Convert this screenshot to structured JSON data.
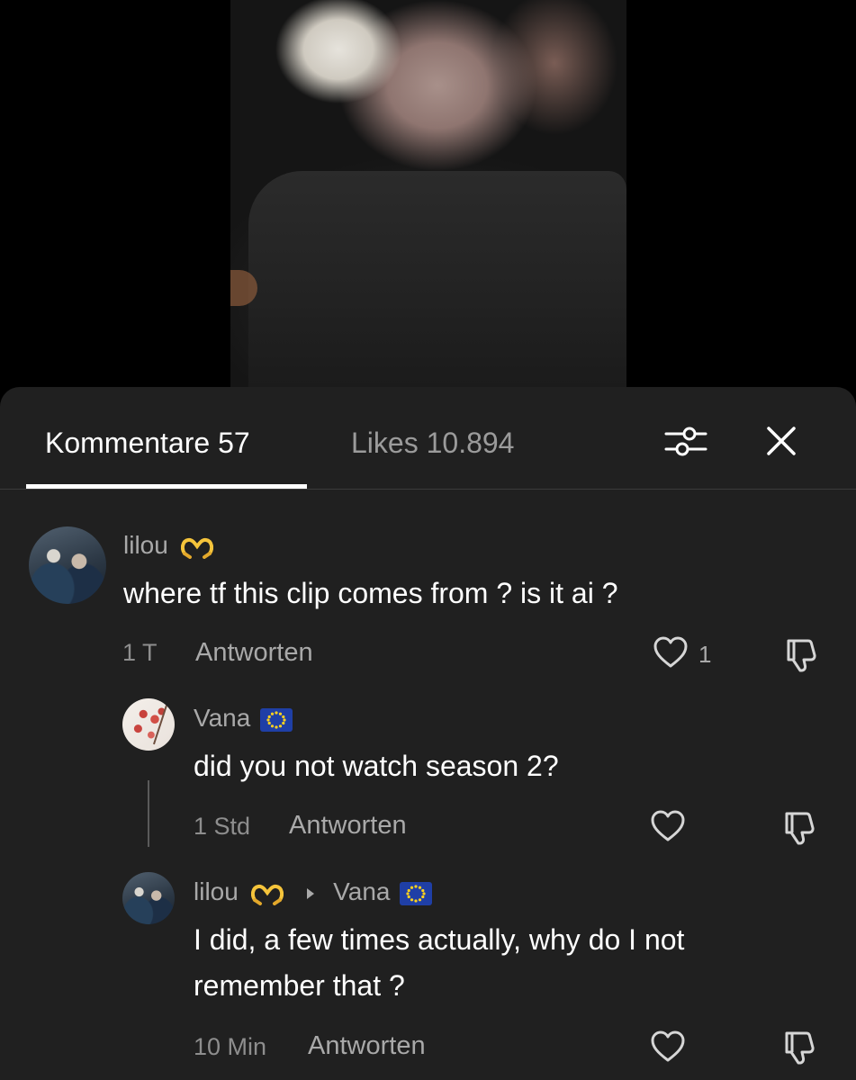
{
  "tabs": {
    "comments_label": "Kommentare 57",
    "likes_label": "Likes 10.894"
  },
  "icons": {
    "filter": "filter-sliders-icon",
    "close": "close-icon",
    "like": "heart-outline-icon",
    "dislike": "thumbs-down-outline-icon",
    "reply_arrow": "caret-right-icon",
    "heart_hands": "heart-hands-emoji",
    "eu_flag": "eu-flag-emoji"
  },
  "colors": {
    "sheet_bg": "#202020",
    "emoji_yellow": "#F5C43B",
    "flag_blue": "#1F3FA6",
    "flag_star": "#FFD21F"
  },
  "comments": [
    {
      "username": "lilou",
      "text": "where tf this clip comes from ? is it ai ?",
      "time": "1 T",
      "reply_label": "Antworten",
      "likes": "1"
    },
    {
      "username": "Vana",
      "text": "did you not watch season 2?",
      "time": "1 Std",
      "reply_label": "Antworten"
    },
    {
      "username": "lilou",
      "reply_to": "Vana",
      "text_line1": "I did, a few times actually, why do I not",
      "text_line2": "remember that ?",
      "time": "10 Min",
      "reply_label": "Antworten"
    }
  ]
}
